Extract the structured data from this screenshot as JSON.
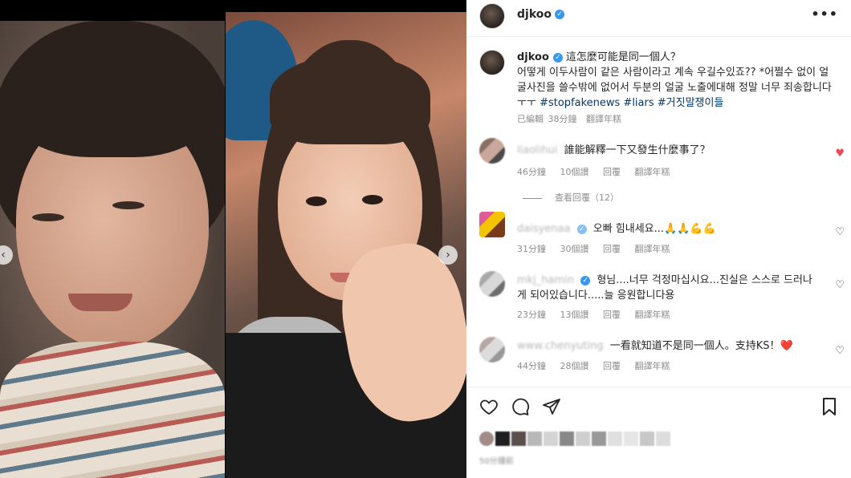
{
  "post": {
    "username": "djkoo",
    "verified_mark": "✓",
    "more_icon": "•••",
    "caption_user": "djkoo",
    "caption_line1": "這怎麼可能是同一個人？",
    "caption_body": "어떻게 이두사람이 같은 사람이라고 계속 우길수있죠?? *어쩔수 없이 얼굴사진을 쓸수밖에 없어서 두분의 얼굴 노출에대해 정말 너무 죄송합니다 ㅜㅜ",
    "hashtags": [
      "#stopfakenews",
      "#liars",
      "#거짓말쟁이들"
    ],
    "edited": "已編輯",
    "age": "38分鐘",
    "translate": "翻譯年糕"
  },
  "comments": [
    {
      "user": "liaolihui",
      "text": "誰能解釋一下又發生什麼事了？",
      "time": "46分鐘",
      "likes": "10個讚",
      "reply": "回覆",
      "translate": "翻譯年糕",
      "liked": true,
      "colors": [
        "#8a6f63",
        "#caa79a",
        "#4a4a4a"
      ]
    },
    {
      "user": "daisyenaa",
      "text": "오빠 힘내세요...🙏🙏💪💪",
      "time": "31分鐘",
      "likes": "30個讚",
      "reply": "回覆",
      "translate": "翻譯年糕",
      "liked": false,
      "colors": [
        "#e05a9a",
        "#f5c400",
        "#7a3b1a"
      ]
    },
    {
      "user": "mkj_hamin",
      "text": "형님....너무 걱정마십시요...진실은 스스로 드러나게 되어있습니다.....늘 응원합니다용",
      "time": "23分鐘",
      "likes": "13個讚",
      "reply": "回覆",
      "translate": "翻譯年糕",
      "liked": false,
      "colors": [
        "#a9a9a9",
        "#d8d8d8",
        "#6e6e6e"
      ]
    },
    {
      "user": "www.chenyuting",
      "text": "一看就知道不是同一個人。支持KS！❤️",
      "time": "44分鐘",
      "likes": "28個讚",
      "reply": "回覆",
      "translate": "翻譯年糕",
      "liked": false,
      "colors": [
        "#b7a6a6",
        "#dcdcdc",
        "#999999"
      ]
    }
  ],
  "view_replies": "查看回覆（12）",
  "footer": {
    "post_time": "50分鐘前",
    "like_colors": [
      "#a38b87",
      "#1f1f1f",
      "#5b4f4d",
      "#b8b8b8",
      "#d4d4d4",
      "#888888",
      "#cfcfcf",
      "#999999",
      "#e0e0e0",
      "#e6e6e6",
      "#c8c8c8",
      "#dddddd"
    ]
  },
  "icons": {
    "heart": "heart-icon",
    "comment": "comment-icon",
    "share": "share-icon",
    "bookmark": "bookmark-icon",
    "more": "more-icon",
    "verified": "verified-badge-icon",
    "carousel_prev": "chevron-left-icon",
    "carousel_next": "chevron-right-icon"
  },
  "colors": {
    "verified_blue": "#3897f0",
    "like_red": "#ed4956",
    "hashtag_blue": "#00376b",
    "meta_gray": "#8e8e8e"
  }
}
